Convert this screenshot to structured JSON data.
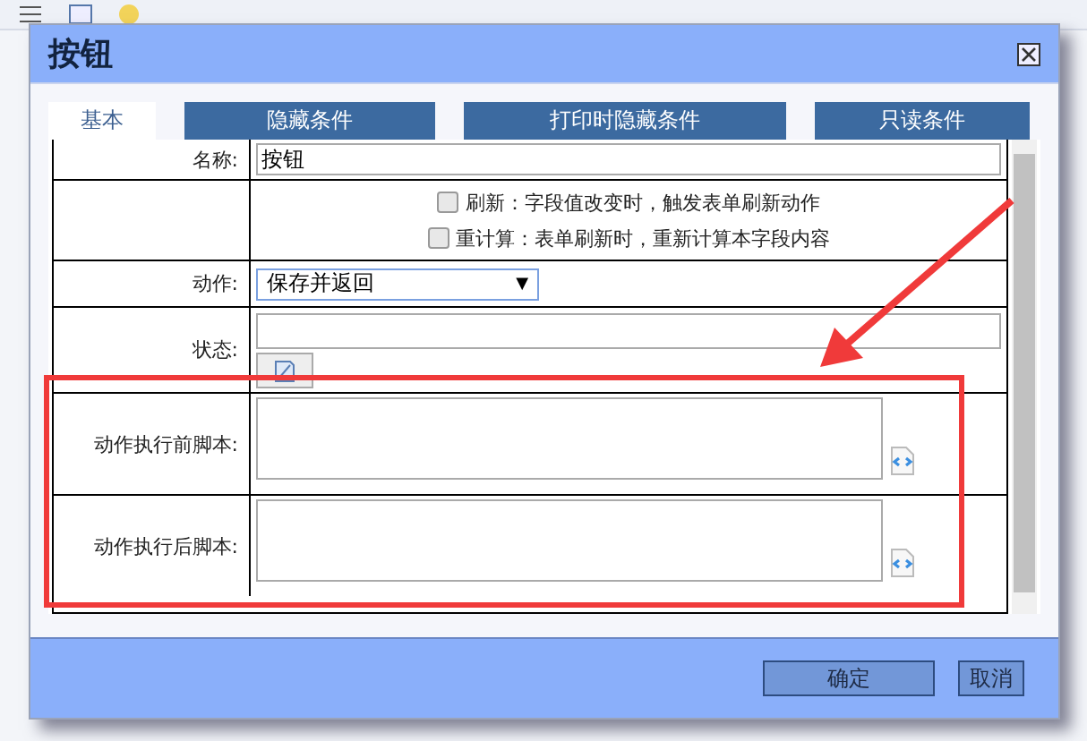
{
  "dialog": {
    "title": "按钮"
  },
  "tabs": [
    {
      "label": "基本",
      "selected": true
    },
    {
      "label": "隐藏条件",
      "selected": false
    },
    {
      "label": "打印时隐藏条件",
      "selected": false
    },
    {
      "label": "只读条件",
      "selected": false
    }
  ],
  "form": {
    "rows": [
      {
        "kind": "text",
        "label": "名称:",
        "value": "按钮"
      },
      {
        "kind": "checks",
        "options": [
          {
            "label": "刷新：字段值改变时，触发表单刷新动作",
            "checked": false
          },
          {
            "label": "重计算：表单刷新时，重新计算本字段内容",
            "checked": false
          }
        ]
      },
      {
        "kind": "select",
        "label": "动作:",
        "value": "保存并返回",
        "arrow": "▼"
      },
      {
        "kind": "state",
        "label": "状态:"
      },
      {
        "kind": "script",
        "label": "动作执行前脚本:"
      },
      {
        "kind": "script",
        "label": "动作执行后脚本:"
      }
    ]
  },
  "buttons": [
    {
      "label": "确定",
      "kind": "primary"
    },
    {
      "label": "取消",
      "kind": "secondary"
    }
  ]
}
